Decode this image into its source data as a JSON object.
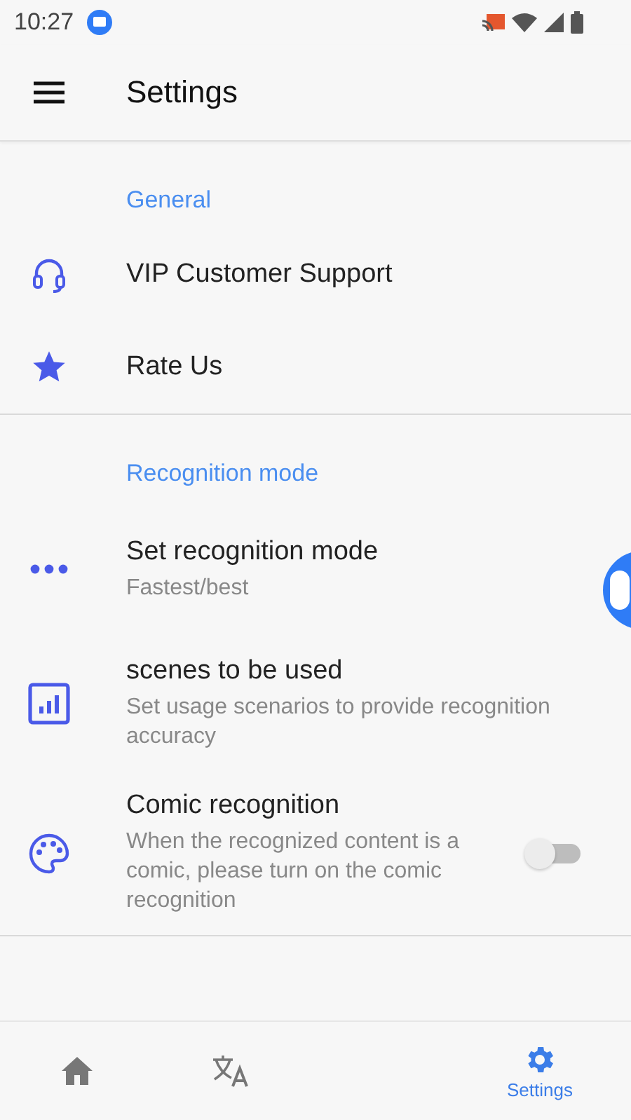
{
  "status_bar": {
    "time": "10:27"
  },
  "toolbar": {
    "title": "Settings"
  },
  "sections": [
    {
      "header": "General",
      "items": [
        {
          "kind": "plain",
          "title": "VIP Customer Support"
        },
        {
          "kind": "plain",
          "title": "Rate Us"
        }
      ]
    },
    {
      "header": "Recognition mode",
      "items": [
        {
          "kind": "plain",
          "title": "Set recognition mode",
          "subtitle": "Fastest/best"
        },
        {
          "kind": "plain",
          "title": "scenes to be used",
          "subtitle": "Set usage scenarios to provide recognition accuracy"
        },
        {
          "kind": "toggle",
          "title": "Comic recognition",
          "subtitle": "When the recognized content is a comic, please turn on the comic recognition",
          "on": false
        }
      ]
    }
  ],
  "bottom_nav": [
    {
      "selected": false
    },
    {
      "selected": false
    },
    {
      "label": "Settings",
      "selected": true
    }
  ]
}
